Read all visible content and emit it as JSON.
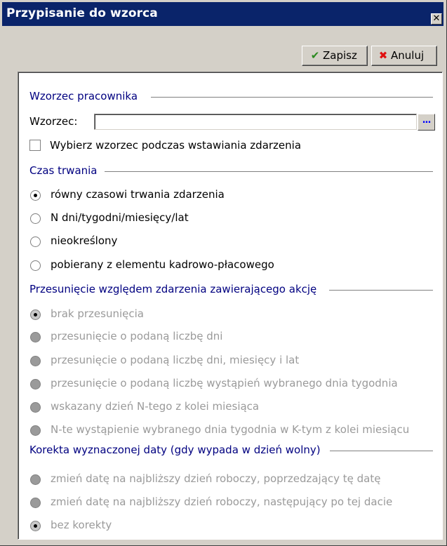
{
  "window": {
    "title": "Przypisanie do wzorca",
    "close_label": "✕"
  },
  "toolbar": {
    "save_label": "Zapisz",
    "cancel_label": "Anuluj"
  },
  "employee_pattern": {
    "heading": "Wzorzec pracownika",
    "field_label": "Wzorzec:",
    "field_value": "",
    "browse_label": "...",
    "checkbox_label": "Wybierz wzorzec podczas wstawiania zdarzenia",
    "checkbox_checked": false
  },
  "duration": {
    "heading": "Czas trwania",
    "options": [
      {
        "label": "równy czasowi trwania zdarzenia",
        "checked": true
      },
      {
        "label": "N dni/tygodni/miesięcy/lat",
        "checked": false
      },
      {
        "label": "nieokreślony",
        "checked": false
      },
      {
        "label": "pobierany z elementu kadrowo-płacowego",
        "checked": false
      }
    ]
  },
  "offset": {
    "heading": "Przesunięcie względem zdarzenia zawierającego akcję",
    "options": [
      {
        "label": "brak przesunięcia",
        "checked": true
      },
      {
        "label": "przesunięcie o podaną liczbę dni",
        "checked": false
      },
      {
        "label": "przesunięcie o podaną liczbę dni, miesięcy i lat",
        "checked": false
      },
      {
        "label": "przesunięcie o podaną liczbę wystąpień wybranego dnia tygodnia",
        "checked": false
      },
      {
        "label": "wskazany dzień N-tego z kolei miesiąca",
        "checked": false
      },
      {
        "label": "N-te wystąpienie wybranego dnia tygodnia w K-tym z kolei miesiącu",
        "checked": false
      }
    ]
  },
  "correction": {
    "heading": "Korekta wyznaczonej daty (gdy wypada w dzień wolny)",
    "options": [
      {
        "label": "zmień datę na najbliższy dzień roboczy, poprzedzający tę datę",
        "checked": false
      },
      {
        "label": "zmień datę na najbliższy dzień roboczy, następujący po tej dacie",
        "checked": false
      },
      {
        "label": "bez korekty",
        "checked": true
      }
    ]
  },
  "colors": {
    "titlebar": "#0a246a",
    "section_heading": "#000080",
    "disabled_text": "#9a9a9a"
  }
}
